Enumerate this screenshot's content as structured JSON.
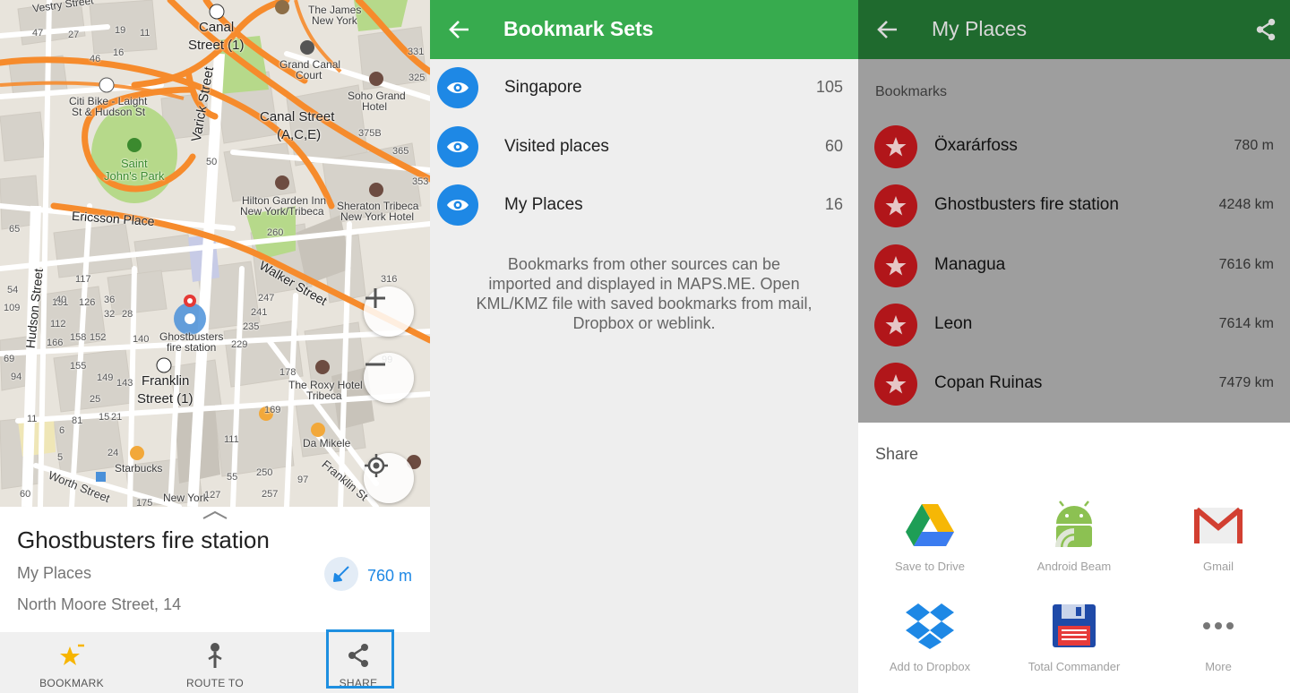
{
  "map": {
    "labels": {
      "vestry": "Vestry Street",
      "canal1_a": "Canal",
      "canal1_b": "Street (1)",
      "james_a": "The James",
      "james_b": "New York",
      "grandcanal_a": "Grand Canal",
      "grandcanal_b": "Court",
      "soho_a": "Soho Grand",
      "soho_b": "Hotel",
      "citibike_a": "Citi Bike - Laight",
      "citibike_b": "St & Hudson St",
      "varick": "Varick Street",
      "canalst_a": "Canal Street",
      "canalst_b": "(A,C,E)",
      "park_a": "Saint",
      "park_b": "John's Park",
      "hilton_a": "Hilton Garden Inn",
      "hilton_b": "New York/Tribeca",
      "sheraton_a": "Sheraton Tribeca",
      "sheraton_b": "New York Hotel",
      "ericsson": "Ericsson Place",
      "walker": "Walker Street",
      "hudson": "Hudson Street",
      "ghost_a": "Ghostbusters",
      "ghost_b": "fire station",
      "franklin_a": "Franklin",
      "franklin_b": "Street (1)",
      "roxy_a": "The Roxy Hotel",
      "roxy_b": "Tribeca",
      "damikele": "Da Mikele",
      "starbucks": "Starbucks",
      "worth": "Worth Street",
      "franklin_st": "Franklin St",
      "newyork": "New York"
    },
    "numbers": [
      "19",
      "11",
      "16",
      "46",
      "47",
      "27",
      "331",
      "325",
      "375B",
      "365",
      "353",
      "50",
      "260",
      "316",
      "247",
      "241",
      "235",
      "229",
      "178",
      "169",
      "111",
      "250",
      "257",
      "97",
      "99",
      "55",
      "24",
      "149",
      "143",
      "140",
      "155",
      "166",
      "158",
      "152",
      "112",
      "131",
      "126",
      "117",
      "54",
      "40",
      "36",
      "32",
      "28",
      "25",
      "21",
      "15",
      "11",
      "6",
      "5",
      "109",
      "94",
      "65",
      "175",
      "127",
      "60",
      "69",
      "81"
    ]
  },
  "place": {
    "title": "Ghostbusters fire station",
    "category": "My Places",
    "address": "North Moore Street, 14",
    "distance": "760 m"
  },
  "actions": {
    "bookmark": "BOOKMARK",
    "route": "ROUTE TO",
    "share": "SHARE"
  },
  "sets": {
    "title": "Bookmark Sets",
    "items": [
      {
        "name": "Singapore",
        "count": "105"
      },
      {
        "name": "Visited places",
        "count": "60"
      },
      {
        "name": "My Places",
        "count": "16"
      }
    ],
    "info": "Bookmarks from other sources can be imported and displayed in MAPS.ME. Open KML/KMZ file with saved bookmarks from mail, Dropbox or weblink."
  },
  "places": {
    "title": "My Places",
    "section": "Bookmarks",
    "items": [
      {
        "name": "Öxarárfoss",
        "distance": "780 m"
      },
      {
        "name": "Ghostbusters fire station",
        "distance": "4248 km"
      },
      {
        "name": "Managua",
        "distance": "7616 km"
      },
      {
        "name": "Leon",
        "distance": "7614 km"
      },
      {
        "name": "Copan Ruinas",
        "distance": "7479 km"
      }
    ]
  },
  "share": {
    "title": "Share",
    "targets": [
      {
        "label": "Save to Drive",
        "icon": "google-drive-icon"
      },
      {
        "label": "Android Beam",
        "icon": "android-beam-icon"
      },
      {
        "label": "Gmail",
        "icon": "gmail-icon"
      },
      {
        "label": "Add to Dropbox",
        "icon": "dropbox-icon"
      },
      {
        "label": "Total Commander",
        "icon": "floppy-disk-icon"
      },
      {
        "label": "More",
        "icon": "more-dots-icon"
      }
    ]
  },
  "colors": {
    "green": "#37ab4e",
    "dark_green": "#1f6a2e",
    "blue": "#1e88e5",
    "bookmark_red": "#b1161a",
    "road_orange": "#f68b2c",
    "park_green": "#b6d98a"
  }
}
